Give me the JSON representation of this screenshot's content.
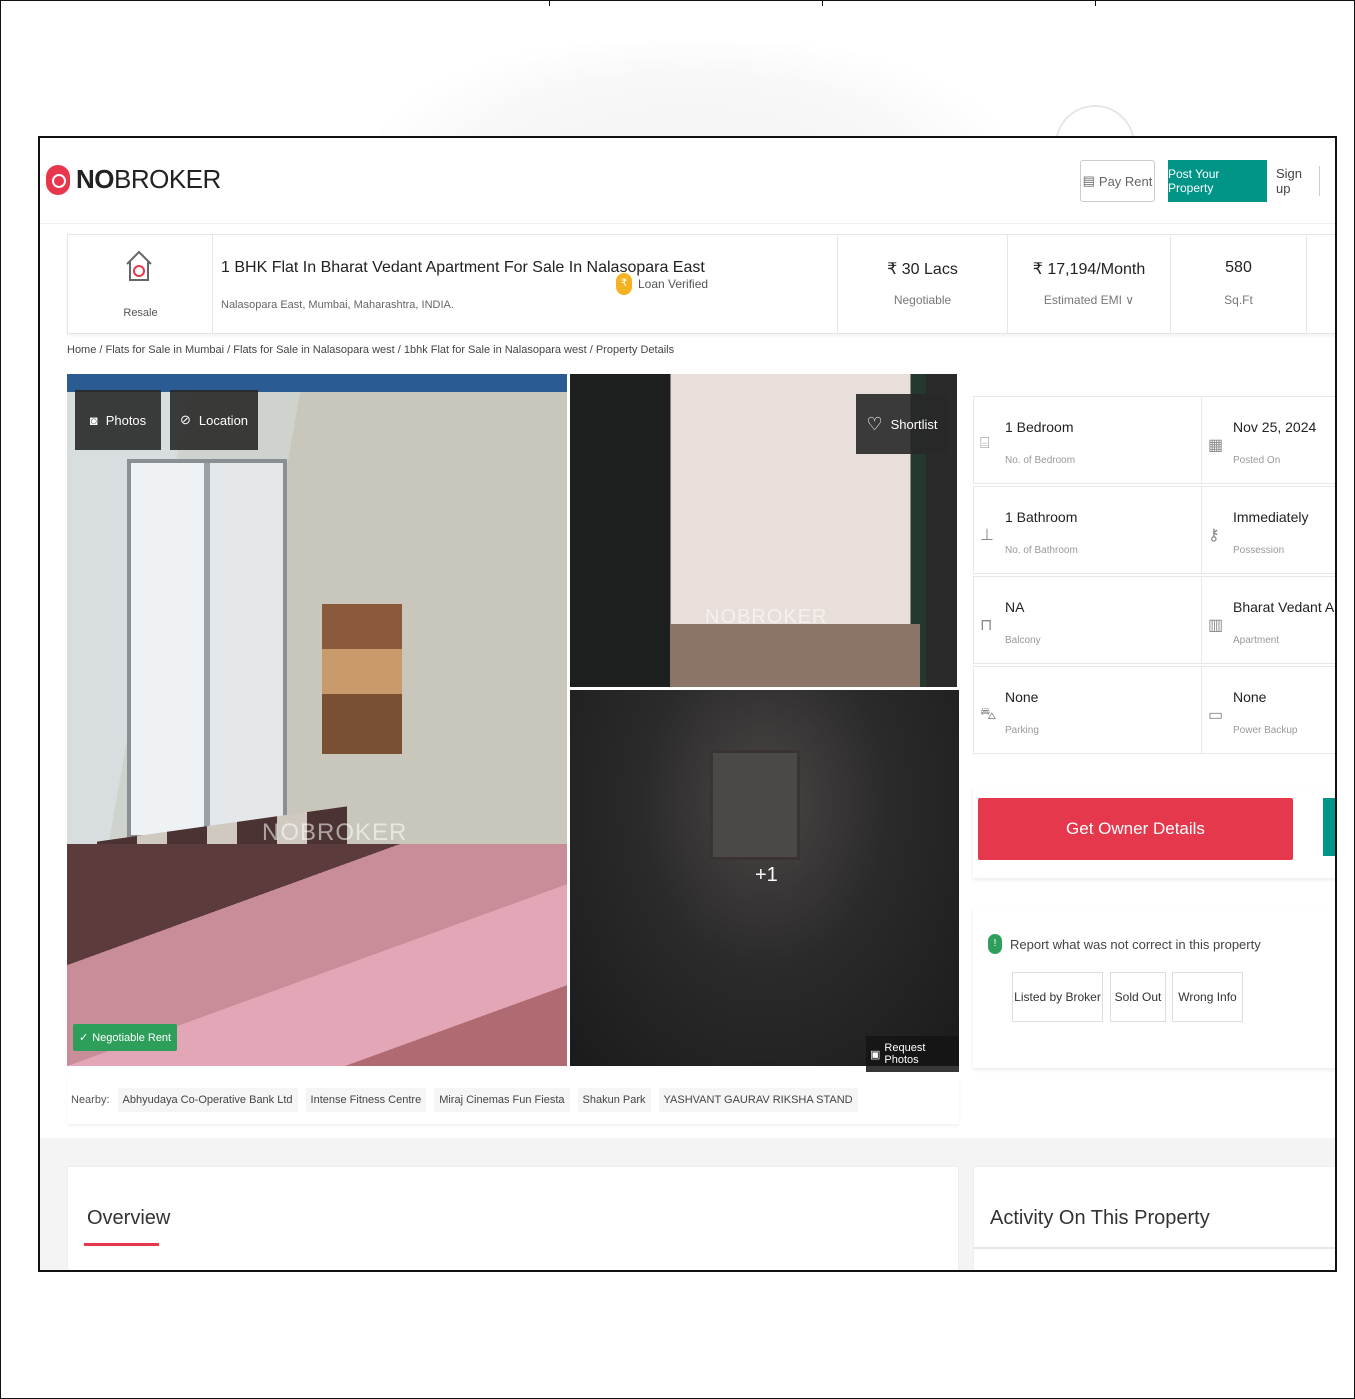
{
  "brand": {
    "prefix": "NO",
    "suffix": "BROKER"
  },
  "header": {
    "pay_rent": "Pay Rent",
    "post_property": "Post Your Property",
    "signup": "Sign up"
  },
  "summary": {
    "listing_type": "Resale",
    "title": "1 BHK Flat In Bharat Vedant Apartment For Sale In Nalasopara East",
    "address": "Nalasopara East, Mumbai, Maharashtra, INDIA.",
    "loan_badge": "Loan Verified",
    "price": "₹ 30 Lacs",
    "price_note": "Negotiable",
    "emi": "₹ 17,194/Month",
    "emi_note": "Estimated EMI ∨",
    "area": "580",
    "area_unit": "Sq.Ft"
  },
  "breadcrumb": "Home / Flats for Sale in Mumbai / Flats for Sale in Nalasopara west / 1bhk Flat for Sale in Nalasopara west / Property Details",
  "gallery": {
    "photos_btn": "Photos",
    "location_btn": "Location",
    "shortlist_btn": "Shortlist",
    "more_count": "+1",
    "negotiable_badge": "Negotiable Rent",
    "request_photos": "Request Photos",
    "watermark": "NOBROKER"
  },
  "nearby": {
    "label": "Nearby:",
    "places": [
      "Abhyudaya Co-Operative Bank Ltd",
      "Intense Fitness Centre",
      "Miraj Cinemas Fun Fiesta",
      "Shakun Park",
      "YASHVANT GAURAV RIKSHA STAND"
    ]
  },
  "details": [
    {
      "value": "1 Bedroom",
      "label": "No. of Bedroom",
      "icon": "bed-icon"
    },
    {
      "value": "Nov 25, 2024",
      "label": "Posted On",
      "icon": "calendar-icon"
    },
    {
      "value": "1 Bathroom",
      "label": "No. of Bathroom",
      "icon": "bath-icon"
    },
    {
      "value": "Immediately",
      "label": "Possession",
      "icon": "key-icon"
    },
    {
      "value": "NA",
      "label": "Balcony",
      "icon": "balcony-icon"
    },
    {
      "value": "Bharat Vedant Apar...",
      "label": "Apartment",
      "icon": "building-icon"
    },
    {
      "value": "None",
      "label": "Parking",
      "icon": "car-icon"
    },
    {
      "value": "None",
      "label": "Power Backup",
      "icon": "battery-icon"
    }
  ],
  "owner_button": "Get Owner Details",
  "report": {
    "heading": "Report what was not correct in this property",
    "options": [
      "Listed by Broker",
      "Sold Out",
      "Wrong Info"
    ]
  },
  "sections": {
    "overview": "Overview",
    "activity": "Activity On This Property"
  },
  "colors": {
    "brand_red": "#e5384c",
    "teal": "#009587",
    "green": "#2e9e5b",
    "loan_yellow": "#f5b324"
  }
}
